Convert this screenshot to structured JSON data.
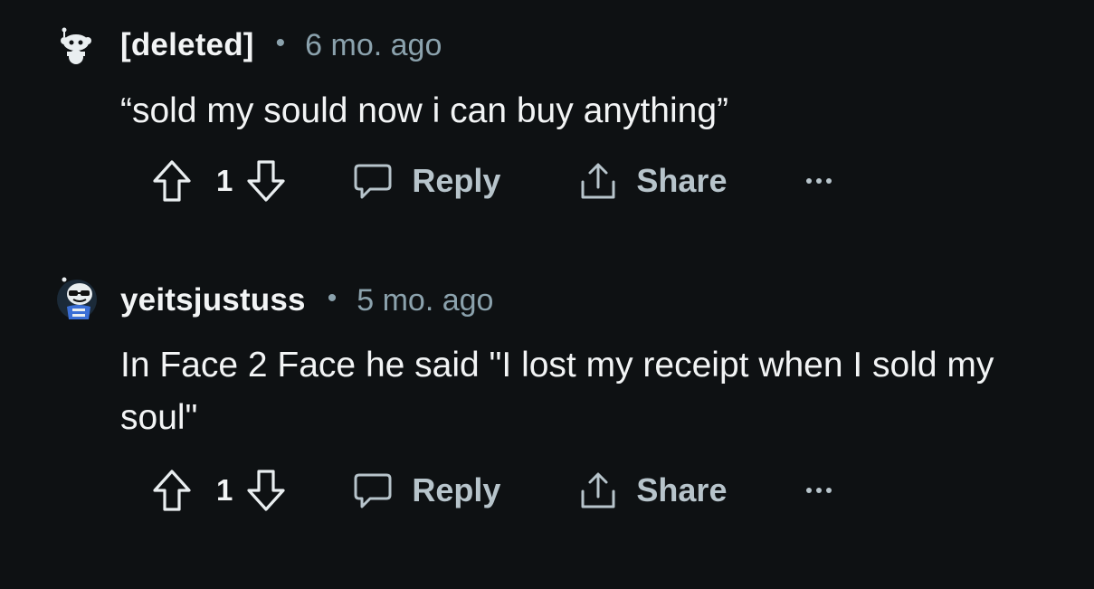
{
  "colors": {
    "background": "#0e1113",
    "primary_text": "#f2f4f5",
    "secondary_text": "#8ba2ad",
    "action_text": "#b7c4cb"
  },
  "comments": [
    {
      "username": "[deleted]",
      "separator": "•",
      "timestamp": "6 mo. ago",
      "body": "“sold my sould now i can buy anything”",
      "avatar_icon": "deleted-user-avatar-icon",
      "vote_count": "1",
      "reply_label": "Reply",
      "share_label": "Share",
      "more_label": "···"
    },
    {
      "username": "yeitsjustuss",
      "separator": "•",
      "timestamp": "5 mo. ago",
      "body": "In Face 2 Face he said \"I lost my receipt when I sold my soul\"",
      "avatar_icon": "snoo-sunglasses-avatar-icon",
      "vote_count": "1",
      "reply_label": "Reply",
      "share_label": "Share",
      "more_label": "···"
    }
  ]
}
